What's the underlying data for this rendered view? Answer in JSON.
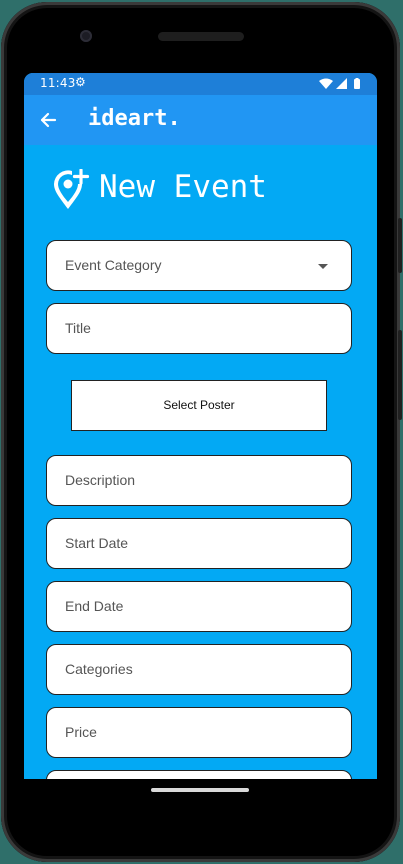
{
  "status_bar": {
    "time": "11:43",
    "settings_icon": "gear-icon",
    "icons": [
      "wifi-icon",
      "signal-icon",
      "battery-icon"
    ]
  },
  "app_bar": {
    "back_icon": "arrow-left-icon",
    "title": "ideart."
  },
  "page": {
    "icon": "add-location-icon",
    "title": "New Event"
  },
  "form": {
    "event_category": {
      "label": "Event Category",
      "type": "dropdown"
    },
    "title": {
      "placeholder": "Title"
    },
    "select_poster_label": "Select Poster",
    "description": {
      "placeholder": "Description"
    },
    "start_date": {
      "placeholder": "Start Date"
    },
    "end_date": {
      "placeholder": "End Date"
    },
    "categories": {
      "placeholder": "Categories"
    },
    "price": {
      "placeholder": "Price"
    },
    "next_field": {
      "placeholder": ""
    }
  },
  "colors": {
    "status_bar": "#1e7fd8",
    "app_bar": "#2196f3",
    "background": "#03a9f4",
    "field_bg": "#ffffff",
    "field_border": "#222222"
  }
}
